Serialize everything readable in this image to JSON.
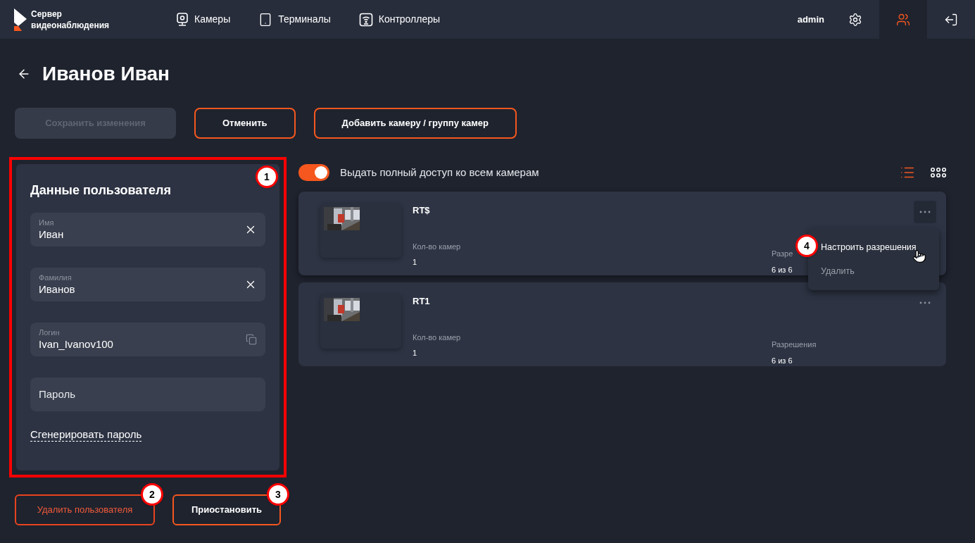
{
  "header": {
    "logo_lines": [
      "Сервер",
      "видеонаблюдения"
    ],
    "nav": [
      {
        "label": "Камеры",
        "kind": "camera"
      },
      {
        "label": "Терминалы",
        "kind": "tablet"
      },
      {
        "label": "Контроллеры",
        "kind": "controller"
      }
    ],
    "user": "admin",
    "actions": [
      {
        "kind": "settings",
        "selected": false
      },
      {
        "kind": "users",
        "selected": true
      },
      {
        "kind": "logout",
        "selected": false
      }
    ]
  },
  "page_title": "Иванов Иван",
  "top_buttons": [
    {
      "label": "Сохранить изменения",
      "disabled": true
    },
    {
      "label": "Отменить",
      "disabled": false
    },
    {
      "label": "Добавить камеру / группу камер",
      "disabled": false
    }
  ],
  "user_panel": {
    "title": "Данные пользователя",
    "annotation": "1",
    "fields": [
      {
        "label": "Имя",
        "value": "Иван",
        "kind": "clear"
      },
      {
        "label": "Фамилия",
        "value": "Иванов",
        "kind": "clear"
      },
      {
        "label": "Логин",
        "value": "Ivan_Ivanov100",
        "kind": "copy"
      },
      {
        "placeholder": "Пароль",
        "kind": "plain"
      }
    ],
    "generate_link": "Сгенерировать пароль"
  },
  "bottom_buttons": [
    {
      "label": "Удалить пользователя",
      "kind": "danger",
      "annotation": "2"
    },
    {
      "label": "Приостановить",
      "kind": "outline",
      "annotation": "3"
    }
  ],
  "full_access": {
    "label": "Выдать полный доступ ко всем камерам",
    "on": true
  },
  "view_modes": [
    {
      "kind": "list",
      "selected": true
    },
    {
      "kind": "grid",
      "selected": false
    }
  ],
  "groups": [
    {
      "name": "RT$",
      "count_label": "Кол-во камер",
      "count": "1",
      "perm_label": "Разре",
      "perm": "6 из 6",
      "menu_open": true
    },
    {
      "name": "RT1",
      "count_label": "Кол-во камер",
      "count": "1",
      "perm_label": "Разрешения",
      "perm": "6 из 6",
      "menu_open": false
    }
  ],
  "context_menu": {
    "annotation": "4",
    "items": [
      {
        "label": "Настроить разрешения",
        "selected": true
      },
      {
        "label": "Удалить",
        "selected": false
      }
    ]
  }
}
